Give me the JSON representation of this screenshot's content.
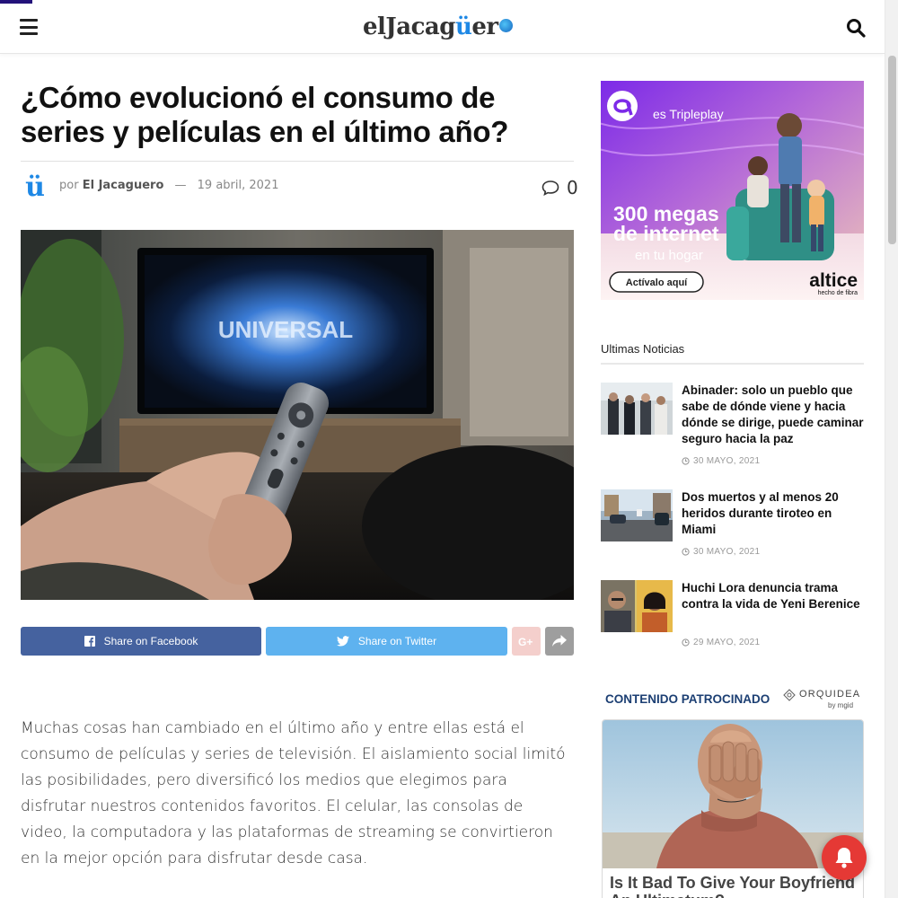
{
  "header": {
    "logo_main": "elJacag",
    "logo_accent": "ü",
    "logo_end": "er"
  },
  "article": {
    "title": "¿Cómo evolucionó el consumo de series y películas en el último año?",
    "author_prefix": "por",
    "author": "El Jacaguero",
    "separator": "—",
    "date": "19 abril, 2021",
    "comment_count": "0",
    "avatar_letter": "ü",
    "body": "Muchas cosas han cambiado en el último año y entre ellas está el consumo de películas y series de televisión. El aislamiento social limitó las posibilidades, pero diversificó los medios que elegimos para disfrutar nuestros contenidos favoritos. El celular, las consolas de video, la computadora y las plataformas de streaming se convirtieron en la mejor opción para disfrutar desde casa."
  },
  "share": {
    "facebook": "Share on Facebook",
    "twitter": "Share on Twitter"
  },
  "ad": {
    "brand_line": "es Tripleplay",
    "headline_1": "300 megas",
    "headline_2": "de internet",
    "sub": "en tu hogar",
    "cta": "Actívalo aquí",
    "company": "altice",
    "tagline": "hecho de fibra"
  },
  "sidebar": {
    "section_title": "Ultimas Noticias",
    "news": [
      {
        "title": "Abinader: solo un pueblo que sabe de dónde viene y hacia dónde se dirige, puede caminar seguro hacia la paz",
        "date": "30 MAYO, 2021"
      },
      {
        "title": "Dos muertos y al menos 20 heridos durante tiroteo en Miami",
        "date": "30 MAYO, 2021"
      },
      {
        "title": "Huchi Lora denuncia trama contra la vida de Yeni Berenice",
        "date": "29 MAYO, 2021"
      }
    ],
    "sponsored_title": "CONTENIDO PATROCINADO",
    "sponsor_brand": "ORQUIDEA",
    "sponsor_by": "by mgid",
    "sponsor_headline": "Is It Bad To Give Your Boyfriend An Ultimatum?"
  },
  "colors": {
    "facebook": "#45629f",
    "twitter": "#5eb2ef",
    "accent": "#1e88e5",
    "notification": "#e53935"
  }
}
